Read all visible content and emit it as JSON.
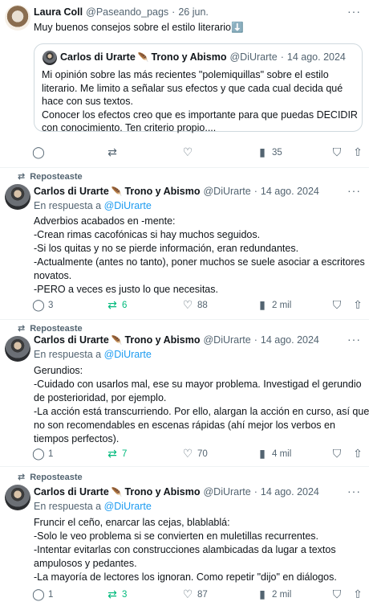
{
  "tweets": [
    {
      "name": "Laura Coll",
      "handle": "@Paseando_pags",
      "dot": "·",
      "date": "26 jun.",
      "more": "···",
      "text": [
        "Muy buenos consejos sobre el estilo literario⬇️"
      ],
      "quote": {
        "name": "Carlos di Urarte",
        "feather": "🪶",
        "name_suffix": "Trono y Abismo",
        "handle": "@DiUrarte",
        "dot": "·",
        "date": "14 ago. 2024",
        "lines": [
          "Mi opinión sobre las más recientes \"polemiquillas\" sobre el estilo",
          "literario. Me limito a señalar sus efectos y que cada cual decida qué",
          "hace con sus textos.",
          "Conocer los efectos creo que es importante para que puedas DECIDIR",
          "con conocimiento. Ten criterio propio...."
        ]
      },
      "actions": {
        "reply": "",
        "repost": "",
        "like": "",
        "views": "35"
      }
    },
    {
      "repost_label": "Reposteaste",
      "name": "Carlos di Urarte",
      "feather": "🪶",
      "name_suffix": "Trono y Abismo",
      "handle": "@DiUrarte",
      "dot": "·",
      "date": "14 ago. 2024",
      "more": "···",
      "reply_prefix": "En respuesta a",
      "reply_to": "@DiUrarte",
      "text": [
        "Adverbios acabados en -mente:",
        "-Crean rimas cacofónicas si hay muchos seguidos.",
        "-Si los quitas y no se pierde información, eran redundantes.",
        "-Actualmente (antes no tanto), poner muchos se suele asociar a escritores",
        "novatos.",
        "-PERO a veces es justo lo que necesitas."
      ],
      "actions": {
        "reply": "3",
        "repost": "6",
        "like": "88",
        "views": "2 mil"
      }
    },
    {
      "repost_label": "Reposteaste",
      "name": "Carlos di Urarte",
      "feather": "🪶",
      "name_suffix": "Trono y Abismo",
      "handle": "@DiUrarte",
      "dot": "·",
      "date": "14 ago. 2024",
      "more": "···",
      "reply_prefix": "En respuesta a",
      "reply_to": "@DiUrarte",
      "text": [
        "Gerundios:",
        "-Cuidado con usarlos mal, ese su mayor problema. Investigad el gerundio",
        "de posterioridad, por ejemplo.",
        "-La acción está transcurriendo. Por ello, alargan la acción en curso, así que",
        "no son recomendables en escenas rápidas (ahí mejor los verbos en",
        "tiempos perfectos)."
      ],
      "actions": {
        "reply": "1",
        "repost": "7",
        "like": "70",
        "views": "4 mil"
      }
    },
    {
      "repost_label": "Reposteaste",
      "name": "Carlos di Urarte",
      "feather": "🪶",
      "name_suffix": "Trono y Abismo",
      "handle": "@DiUrarte",
      "dot": "·",
      "date": "14 ago. 2024",
      "more": "···",
      "reply_prefix": "En respuesta a",
      "reply_to": "@DiUrarte",
      "text": [
        "Fruncir el ceño, enarcar las cejas, blablablá:",
        "-Solo le veo problema si se convierten en muletillas recurrentes.",
        "-Intentar evitarlas con construcciones alambicadas da lugar a textos",
        "ampulosos y pedantes.",
        "-La mayoría de lectores los ignoran. Como repetir \"dijo\" en diálogos."
      ],
      "actions": {
        "reply": "1",
        "repost": "3",
        "like": "87",
        "views": "2 mil"
      }
    }
  ],
  "icons": {
    "reply": "speech-bubble-icon",
    "repost": "repost-arrows-icon",
    "like": "heart-icon",
    "views": "bar-chart-icon",
    "bookmark": "bookmark-icon",
    "share": "share-upload-icon"
  },
  "colors": {
    "link": "#1d9bf0",
    "reposted": "#00ba7c",
    "muted": "#536471"
  }
}
